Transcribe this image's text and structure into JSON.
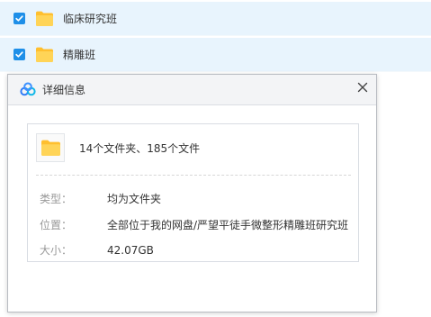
{
  "file_list": {
    "rows": [
      {
        "name": "临床研究班",
        "checked": true,
        "icon": "folder-icon"
      },
      {
        "name": "精雕班",
        "checked": true,
        "icon": "folder-icon"
      }
    ]
  },
  "dialog": {
    "title": "详细信息",
    "logo_icon": "baidu-netdisk-logo",
    "close_icon": "close-icon",
    "summary": "14个文件夹、185个文件",
    "details": [
      {
        "label": "类型：",
        "value": "均为文件夹"
      },
      {
        "label": "位置：",
        "value": "全部位于我的网盘/严望平徒手微整形精雕班研究班"
      },
      {
        "label": "大小：",
        "value": "42.07GB"
      }
    ]
  },
  "colors": {
    "row_selected_bg": "#e8f4fd",
    "checkbox_blue": "#1e8fe8",
    "folder_yellow": "#ffc12f",
    "label_gray": "#999999",
    "text_dark": "#333333"
  }
}
